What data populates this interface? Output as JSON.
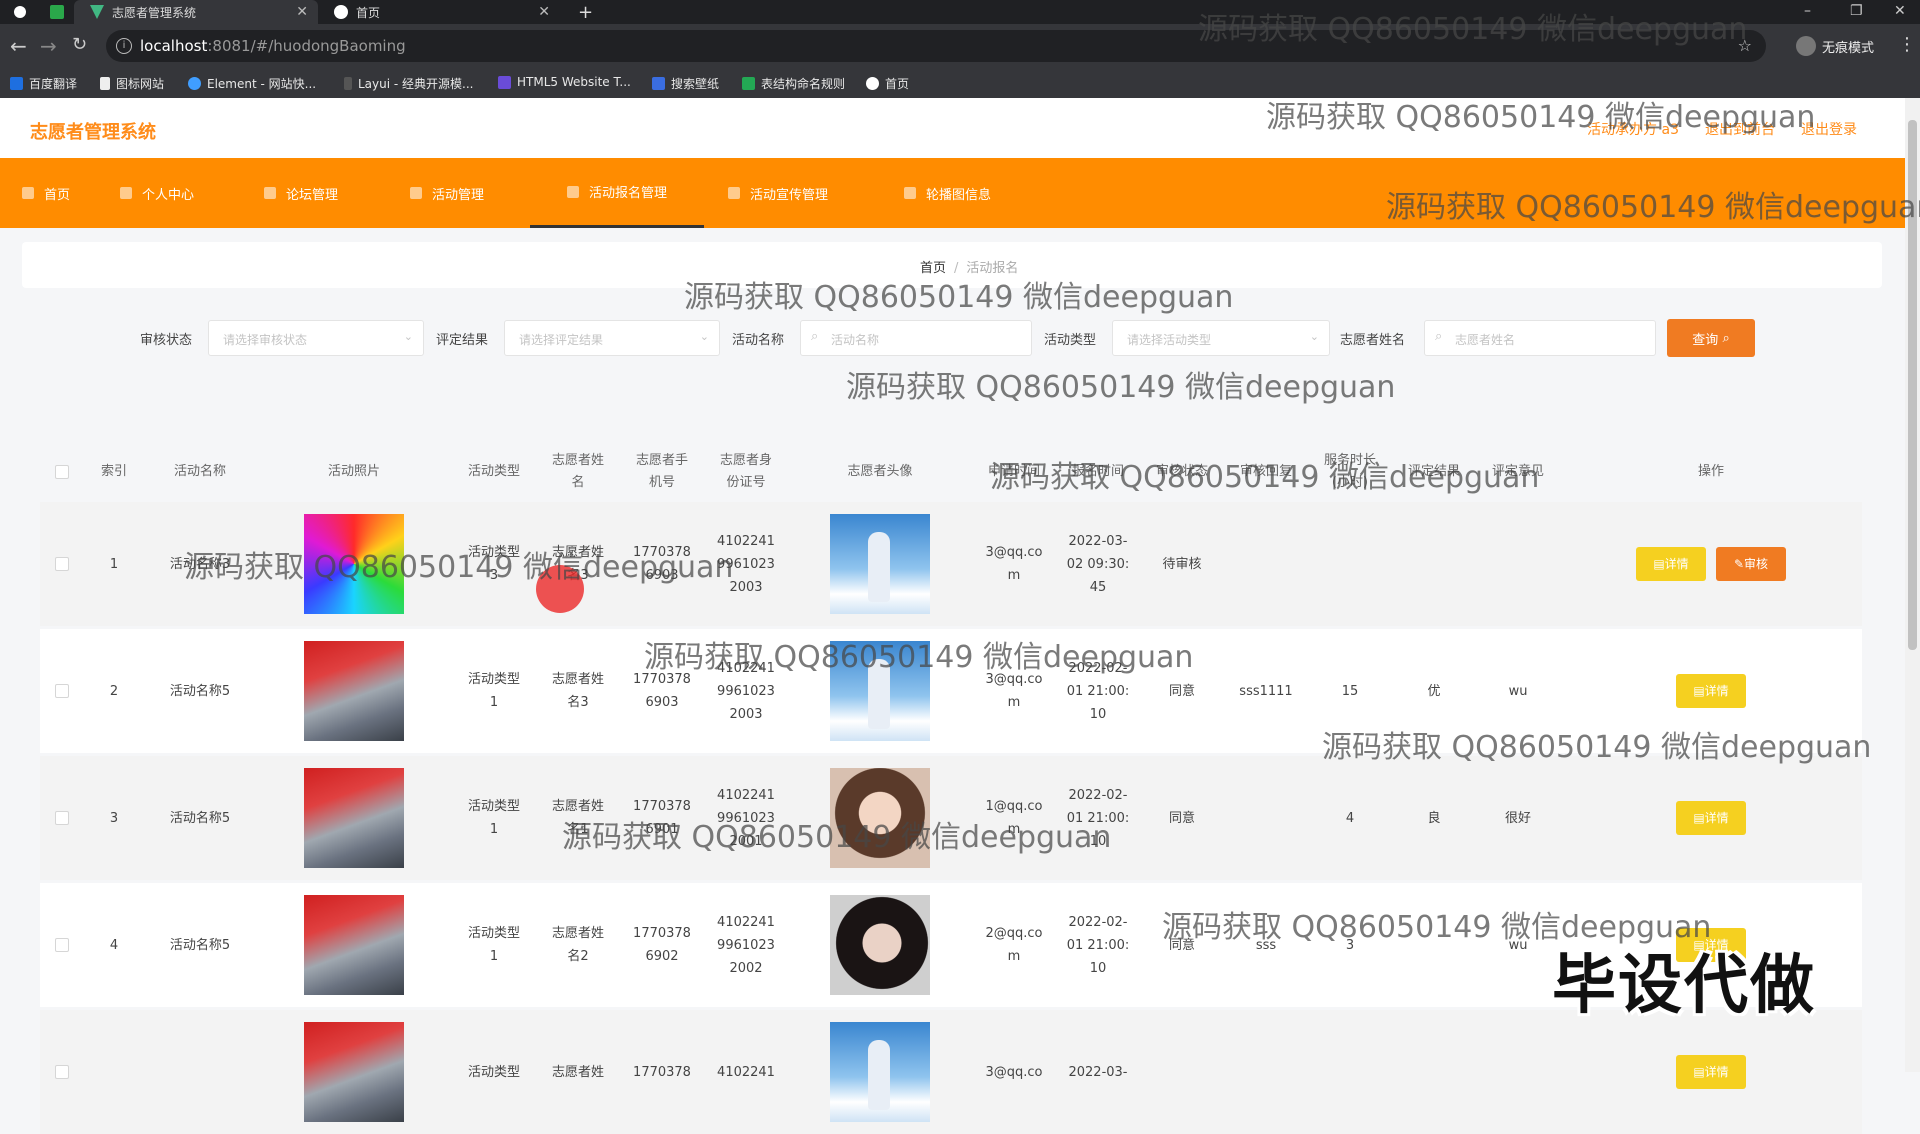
{
  "browser": {
    "tabs": [
      {
        "label": "志愿者管理系统",
        "active": true
      },
      {
        "label": "首页",
        "active": false
      }
    ],
    "new_tab_symbol": "+",
    "url_host": "localhost",
    "url_path": ":8081/#/huodongBaoming",
    "profile_label": "无痕模式",
    "bookmarks": [
      "百度翻译",
      "图标网站",
      "Element - 网站快...",
      "Layui - 经典开源模...",
      "HTML5 Website T...",
      "搜索壁纸",
      "表结构命名规则",
      "首页"
    ]
  },
  "app": {
    "title": "志愿者管理系统",
    "header_links": [
      "活动承办方 a3",
      "退出到前台",
      "退出登录"
    ]
  },
  "nav": {
    "items": [
      {
        "label": "首页",
        "active": false
      },
      {
        "label": "个人中心",
        "active": false
      },
      {
        "label": "论坛管理",
        "active": false
      },
      {
        "label": "活动管理",
        "active": false
      },
      {
        "label": "活动报名管理",
        "active": true
      },
      {
        "label": "活动宣传管理",
        "active": false
      },
      {
        "label": "轮播图信息",
        "active": false
      }
    ]
  },
  "breadcrumb": {
    "home": "首页",
    "separator": "/",
    "current": "活动报名"
  },
  "search": {
    "status_label": "审核状态",
    "status_placeholder": "请选择审核状态",
    "result_label": "评定结果",
    "result_placeholder": "请选择评定结果",
    "name_label": "活动名称",
    "name_placeholder": "活动名称",
    "type_label": "活动类型",
    "type_placeholder": "请选择活动类型",
    "volunteer_label": "志愿者姓名",
    "volunteer_placeholder": "志愿者姓名",
    "query_button": "查询"
  },
  "table": {
    "headers": [
      "索引",
      "活动名称",
      "活动照片",
      "活动类型",
      "志愿者姓\n名",
      "志愿者手\n机号",
      "志愿者身\n份证号",
      "志愿者头像",
      "申请时间",
      "报名时间",
      "审核状态",
      "审核回复",
      "服务时长\n(小时)",
      "评定结果",
      "评定意见",
      "操作"
    ],
    "rows": [
      {
        "index": "1",
        "name": "活动名称3",
        "photo": "rainbow",
        "type": "活动类型\n3",
        "volunteer": "志愿者姓\n名3",
        "phone": "1770378\n6903",
        "id_card": "4102241\n9961023\n2003",
        "avatar": "boy",
        "email": "3@qq.co\nm",
        "time": "2022-03-\n02 09:30:\n45",
        "status": "待审核",
        "reply": "",
        "hours": "",
        "result": "",
        "opinion": "",
        "actions": [
          "详情",
          "审核"
        ]
      },
      {
        "index": "2",
        "name": "活动名称5",
        "photo": "flag",
        "type": "活动类型\n1",
        "volunteer": "志愿者姓\n名3",
        "phone": "1770378\n6903",
        "id_card": "4102241\n9961023\n2003",
        "avatar": "boy",
        "email": "3@qq.co\nm",
        "time": "2022-02-\n01 21:00:\n10",
        "status": "同意",
        "reply": "sss1111",
        "hours": "15",
        "result": "优",
        "opinion": "wu",
        "actions": [
          "详情"
        ]
      },
      {
        "index": "3",
        "name": "活动名称5",
        "photo": "flag",
        "type": "活动类型\n1",
        "volunteer": "志愿者姓\n名1",
        "phone": "1770378\n6901",
        "id_card": "4102241\n9961023\n2001",
        "avatar": "girl",
        "email": "1@qq.co\nm",
        "time": "2022-02-\n01 21:00:\n10",
        "status": "同意",
        "reply": "",
        "hours": "4",
        "result": "良",
        "opinion": "很好",
        "actions": [
          "详情"
        ]
      },
      {
        "index": "4",
        "name": "活动名称5",
        "photo": "flag",
        "type": "活动类型\n1",
        "volunteer": "志愿者姓\n名2",
        "phone": "1770378\n6902",
        "id_card": "4102241\n9961023\n2002",
        "avatar": "woman",
        "email": "2@qq.co\nm",
        "time": "2022-02-\n01 21:00:\n10",
        "status": "同意",
        "reply": "sss",
        "hours": "3",
        "result": "",
        "opinion": "wu",
        "actions": [
          "详情"
        ]
      },
      {
        "index": "",
        "name": "",
        "photo": "flag",
        "type": "活动类型",
        "volunteer": "志愿者姓",
        "phone": "1770378",
        "id_card": "4102241",
        "avatar": "boy",
        "email": "3@qq.co",
        "time": "2022-03-",
        "status": "",
        "reply": "",
        "hours": "",
        "result": "",
        "opinion": "",
        "actions": [
          "详情"
        ]
      }
    ]
  },
  "watermark": "源码获取 QQ86050149 微信deepguan",
  "stamp": "毕设代做",
  "colors": {
    "brand_orange": "#ff8c00",
    "detail_yellow": "#f5d020",
    "audit_orange": "#f07b22"
  }
}
